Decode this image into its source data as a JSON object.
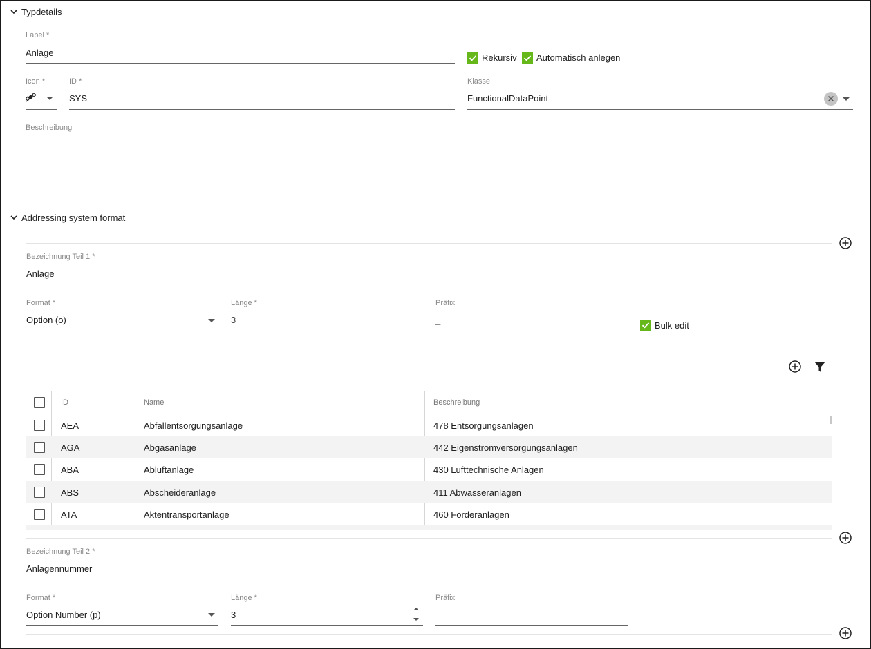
{
  "typdetails": {
    "title": "Typdetails",
    "label_field": {
      "label": "Label",
      "value": "Anlage"
    },
    "rekursiv": {
      "label": "Rekursiv",
      "checked": true
    },
    "auto_anlegen": {
      "label": "Automatisch anlegen",
      "checked": true
    },
    "icon_field": {
      "label": "Icon",
      "icon": "satellite-icon"
    },
    "id_field": {
      "label": "ID",
      "value": "SYS"
    },
    "klasse_field": {
      "label": "Klasse",
      "value": "FunctionalDataPoint"
    },
    "beschreibung_field": {
      "label": "Beschreibung",
      "value": ""
    },
    "required_mark": "*"
  },
  "addressing": {
    "title": "Addressing system format",
    "part1": {
      "bezeichnung_label": "Bezeichnung Teil 1",
      "bezeichnung_value": "Anlage",
      "format_label": "Format",
      "format_value": "Option (o)",
      "laenge_label": "Länge",
      "laenge_value": "3",
      "praefix_label": "Präfix",
      "praefix_value": "_",
      "bulk_edit": {
        "label": "Bulk edit",
        "checked": true
      }
    },
    "table": {
      "columns": [
        "ID",
        "Name",
        "Beschreibung"
      ],
      "rows": [
        {
          "id": "AEA",
          "name": "Abfallentsorgungsanlage",
          "beschreibung": "478 Entsorgungsanlagen"
        },
        {
          "id": "AGA",
          "name": "Abgasanlage",
          "beschreibung": "442 Eigenstromversorgungsanlagen"
        },
        {
          "id": "ABA",
          "name": "Abluftanlage",
          "beschreibung": "430 Lufttechnische Anlagen"
        },
        {
          "id": "ABS",
          "name": "Abscheideranlage",
          "beschreibung": "411 Abwasseranlagen"
        },
        {
          "id": "ATA",
          "name": "Aktentransportanlage",
          "beschreibung": "460 Förderanlagen"
        }
      ]
    },
    "part2": {
      "bezeichnung_label": "Bezeichnung Teil 2",
      "bezeichnung_value": "Anlagennummer",
      "format_label": "Format",
      "format_value": "Option Number (p)",
      "laenge_label": "Länge",
      "laenge_value": "3",
      "praefix_label": "Präfix",
      "praefix_value": ""
    }
  },
  "colors": {
    "checkbox_green": "#66b81a",
    "divider": "#555555",
    "label_gray": "#8a8a8a"
  }
}
